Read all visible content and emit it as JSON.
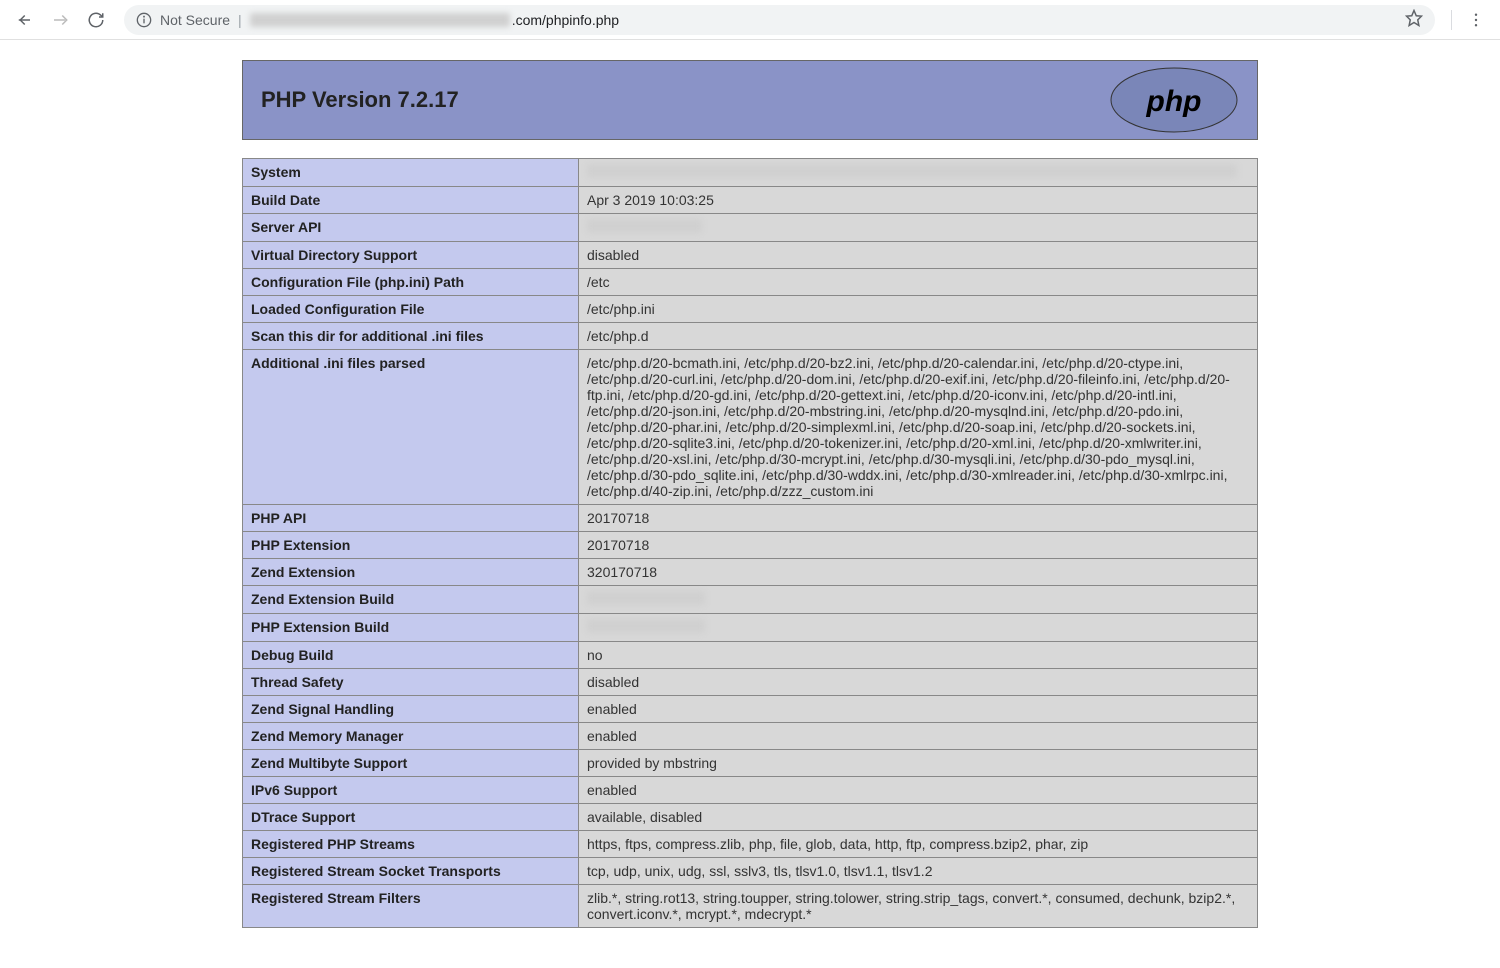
{
  "browser": {
    "not_secure": "Not Secure",
    "url_visible_suffix": ".com/phpinfo.php"
  },
  "header": {
    "title": "PHP Version 7.2.17",
    "logo_text": "php"
  },
  "rows": [
    {
      "key": "System",
      "val": "",
      "blurred": true,
      "blur_width": 650
    },
    {
      "key": "Build Date",
      "val": "Apr 3 2019 10:03:25"
    },
    {
      "key": "Server API",
      "val": "",
      "blurred": true,
      "blur_width": 115
    },
    {
      "key": "Virtual Directory Support",
      "val": "disabled"
    },
    {
      "key": "Configuration File (php.ini) Path",
      "val": "/etc"
    },
    {
      "key": "Loaded Configuration File",
      "val": "/etc/php.ini"
    },
    {
      "key": "Scan this dir for additional .ini files",
      "val": "/etc/php.d"
    },
    {
      "key": "Additional .ini files parsed",
      "val": "/etc/php.d/20-bcmath.ini, /etc/php.d/20-bz2.ini, /etc/php.d/20-calendar.ini, /etc/php.d/20-ctype.ini, /etc/php.d/20-curl.ini, /etc/php.d/20-dom.ini, /etc/php.d/20-exif.ini, /etc/php.d/20-fileinfo.ini, /etc/php.d/20-ftp.ini, /etc/php.d/20-gd.ini, /etc/php.d/20-gettext.ini, /etc/php.d/20-iconv.ini, /etc/php.d/20-intl.ini, /etc/php.d/20-json.ini, /etc/php.d/20-mbstring.ini, /etc/php.d/20-mysqlnd.ini, /etc/php.d/20-pdo.ini, /etc/php.d/20-phar.ini, /etc/php.d/20-simplexml.ini, /etc/php.d/20-soap.ini, /etc/php.d/20-sockets.ini, /etc/php.d/20-sqlite3.ini, /etc/php.d/20-tokenizer.ini, /etc/php.d/20-xml.ini, /etc/php.d/20-xmlwriter.ini, /etc/php.d/20-xsl.ini, /etc/php.d/30-mcrypt.ini, /etc/php.d/30-mysqli.ini, /etc/php.d/30-pdo_mysql.ini, /etc/php.d/30-pdo_sqlite.ini, /etc/php.d/30-wddx.ini, /etc/php.d/30-xmlreader.ini, /etc/php.d/30-xmlrpc.ini, /etc/php.d/40-zip.ini, /etc/php.d/zzz_custom.ini"
    },
    {
      "key": "PHP API",
      "val": "20170718"
    },
    {
      "key": "PHP Extension",
      "val": "20170718"
    },
    {
      "key": "Zend Extension",
      "val": "320170718"
    },
    {
      "key": "Zend Extension Build",
      "val": "",
      "blurred": true,
      "blur_width": 118
    },
    {
      "key": "PHP Extension Build",
      "val": "",
      "blurred": true,
      "blur_width": 118
    },
    {
      "key": "Debug Build",
      "val": "no"
    },
    {
      "key": "Thread Safety",
      "val": "disabled"
    },
    {
      "key": "Zend Signal Handling",
      "val": "enabled"
    },
    {
      "key": "Zend Memory Manager",
      "val": "enabled"
    },
    {
      "key": "Zend Multibyte Support",
      "val": "provided by mbstring"
    },
    {
      "key": "IPv6 Support",
      "val": "enabled"
    },
    {
      "key": "DTrace Support",
      "val": "available, disabled"
    },
    {
      "key": "Registered PHP Streams",
      "val": "https, ftps, compress.zlib, php, file, glob, data, http, ftp, compress.bzip2, phar, zip"
    },
    {
      "key": "Registered Stream Socket Transports",
      "val": "tcp, udp, unix, udg, ssl, sslv3, tls, tlsv1.0, tlsv1.1, tlsv1.2"
    },
    {
      "key": "Registered Stream Filters",
      "val": "zlib.*, string.rot13, string.toupper, string.tolower, string.strip_tags, convert.*, consumed, dechunk, bzip2.*, convert.iconv.*, mcrypt.*, mdecrypt.*"
    }
  ]
}
